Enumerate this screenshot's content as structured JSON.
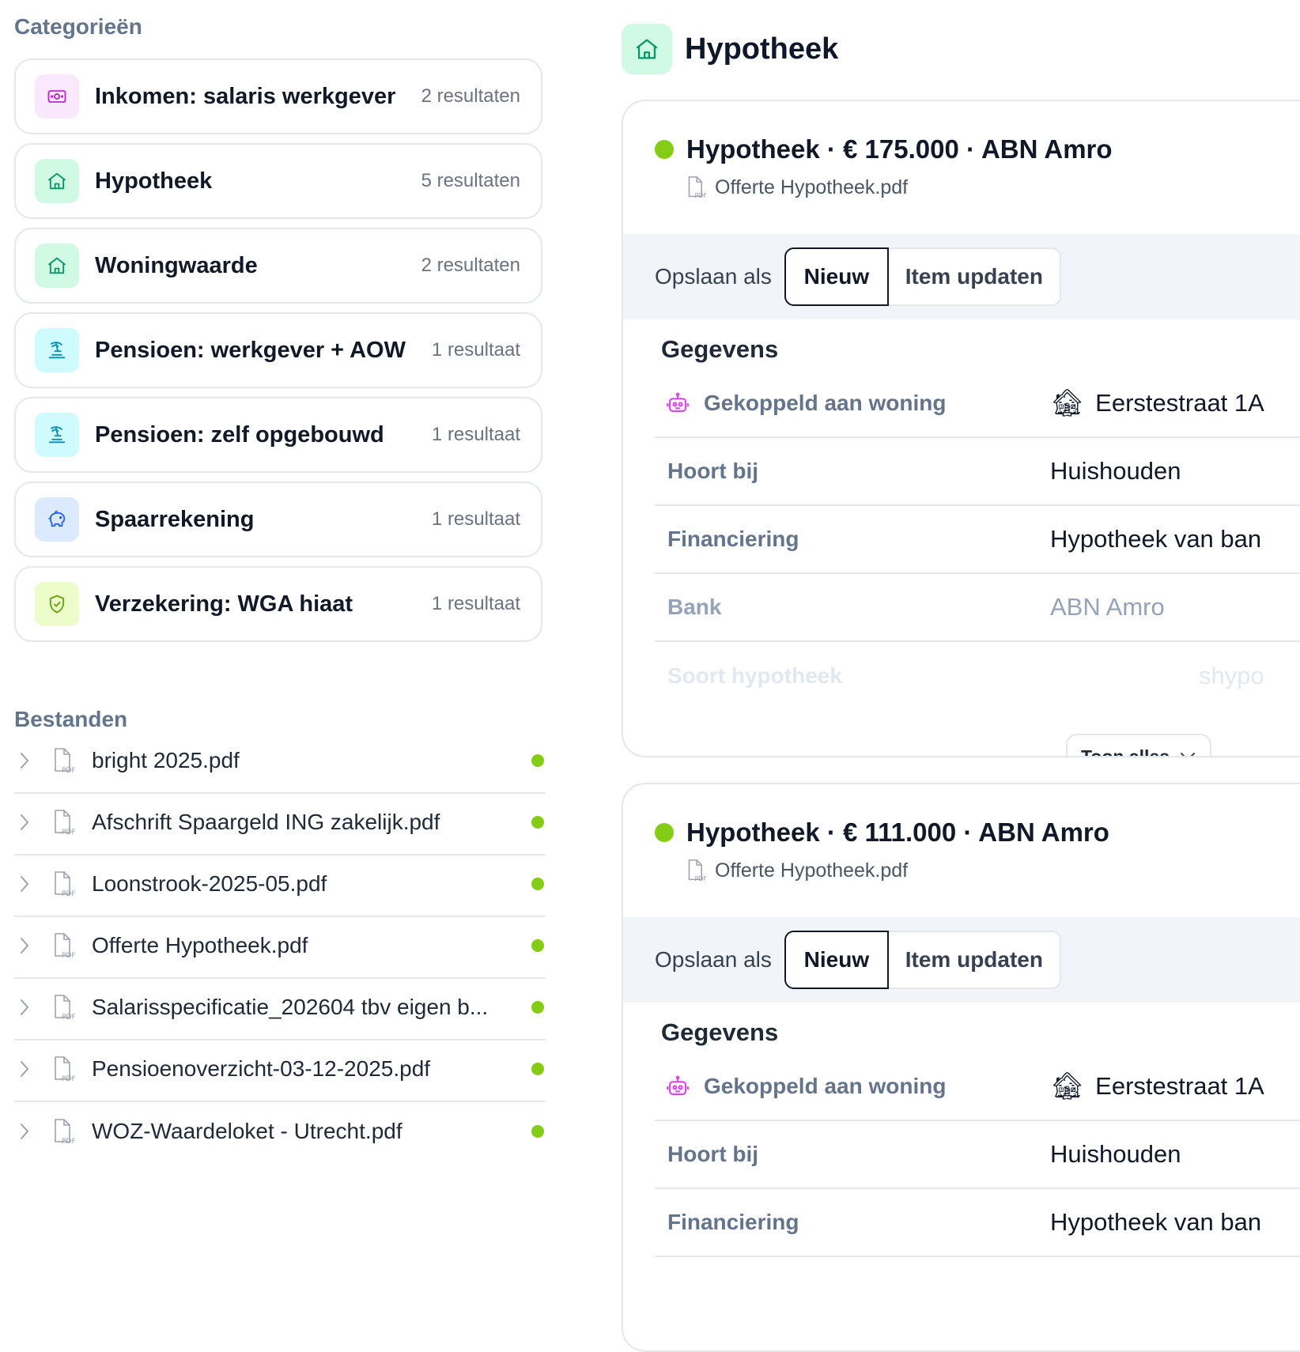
{
  "categories": {
    "title": "Categorieën",
    "items": [
      {
        "label": "Inkomen: salaris werkgever",
        "count": "2 resultaten",
        "icon": "money-icon",
        "color": "#fae8ff",
        "stroke": "#c026d3"
      },
      {
        "label": "Hypotheek",
        "count": "5 resultaten",
        "icon": "home-icon",
        "color": "#d1fae5",
        "stroke": "#059669"
      },
      {
        "label": "Woningwaarde",
        "count": "2 resultaten",
        "icon": "home-icon",
        "color": "#d1fae5",
        "stroke": "#059669"
      },
      {
        "label": "Pensioen: werkgever + AOW",
        "count": "1 resultaat",
        "icon": "palm-icon",
        "color": "#cffafe",
        "stroke": "#0891b2"
      },
      {
        "label": "Pensioen: zelf opgebouwd",
        "count": "1 resultaat",
        "icon": "palm-icon",
        "color": "#cffafe",
        "stroke": "#0891b2"
      },
      {
        "label": "Spaarrekening",
        "count": "1 resultaat",
        "icon": "piggy-bank-icon",
        "color": "#dbeafe",
        "stroke": "#2563eb"
      },
      {
        "label": "Verzekering: WGA hiaat",
        "count": "1 resultaat",
        "icon": "shield-check-icon",
        "color": "#ecfccb",
        "stroke": "#65a30d"
      }
    ]
  },
  "files": {
    "title": "Bestanden",
    "items": [
      {
        "name": "bright 2025.pdf"
      },
      {
        "name": "Afschrift Spaargeld ING zakelijk.pdf"
      },
      {
        "name": "Loonstrook-2025-05.pdf"
      },
      {
        "name": "Offerte Hypotheek.pdf"
      },
      {
        "name": "Salarisspecificatie_202604 tbv eigen b..."
      },
      {
        "name": "Pensioenoverzicht-03-12-2025.pdf"
      },
      {
        "name": "WOZ-Waardeloket - Utrecht.pdf"
      }
    ],
    "status_color": "#84cc16"
  },
  "main": {
    "title": "Hypotheek",
    "cards": [
      {
        "title": "Hypotheek · € 175.000 · ABN Amro",
        "file": "Offerte Hypotheek.pdf",
        "save_label": "Opslaan als",
        "btn_new": "Nieuw",
        "btn_update": "Item updaten",
        "details_title": "Gegevens",
        "rows": [
          {
            "label": "Gekoppeld aan woning",
            "value": "Eerstestraat 1A"
          },
          {
            "label": "Hoort bij",
            "value": "Huishouden"
          },
          {
            "label": "Financiering",
            "value": "Hypotheek van ban"
          },
          {
            "label": "Bank",
            "value": "ABN Amro"
          },
          {
            "label": "Soort hypotheek",
            "value": "shypo"
          }
        ],
        "show_all": "Toon alles"
      },
      {
        "title": "Hypotheek · € 111.000 · ABN Amro",
        "file": "Offerte Hypotheek.pdf",
        "save_label": "Opslaan als",
        "btn_new": "Nieuw",
        "btn_update": "Item updaten",
        "details_title": "Gegevens",
        "rows": [
          {
            "label": "Gekoppeld aan woning",
            "value": "Eerstestraat 1A"
          },
          {
            "label": "Hoort bij",
            "value": "Huishouden"
          },
          {
            "label": "Financiering",
            "value": "Hypotheek van ban"
          }
        ]
      }
    ]
  }
}
